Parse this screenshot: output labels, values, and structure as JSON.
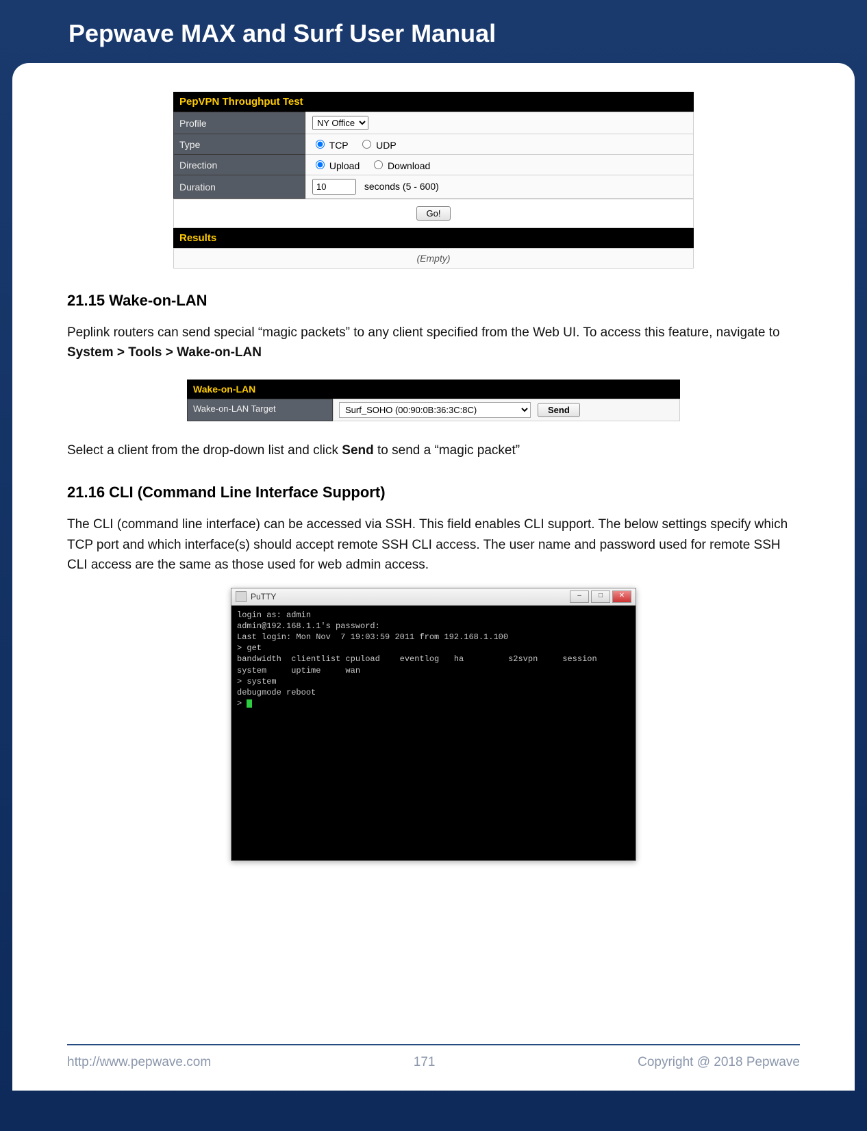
{
  "doc_title": "Pepwave MAX and Surf User Manual",
  "pepvpn": {
    "panel_title": "PepVPN Throughput Test",
    "rows": {
      "profile_label": "Profile",
      "profile_value": "NY Office",
      "type_label": "Type",
      "type_opt_tcp": "TCP",
      "type_opt_udp": "UDP",
      "direction_label": "Direction",
      "direction_opt_up": "Upload",
      "direction_opt_down": "Download",
      "duration_label": "Duration",
      "duration_value": "10",
      "duration_suffix": "seconds (5 - 600)"
    },
    "go_label": "Go!",
    "results_title": "Results",
    "results_empty": "(Empty)"
  },
  "section_wol": {
    "heading": "21.15 Wake-on-LAN",
    "para1_a": "Peplink routers can send special “magic packets” to any client specified from the Web UI. To access this feature, navigate to ",
    "para1_b_bold": "System > Tools > Wake-on-LAN",
    "panel_title": "Wake-on-LAN",
    "row_label": "Wake-on-LAN Target",
    "select_value": "Surf_SOHO (00:90:0B:36:3C:8C)",
    "send_label": "Send",
    "para2_a": "Select a client from the drop-down list and click ",
    "para2_b_bold": "Send",
    "para2_c": " to send a “magic packet”"
  },
  "section_cli": {
    "heading": "21.16 CLI (Command Line Interface Support)",
    "para": "The CLI (command line interface) can be accessed via SSH. This field enables CLI support. The below settings specify which TCP port and which interface(s) should accept remote SSH CLI access. The user name and password used for remote SSH CLI access are the same as those used for web admin access.",
    "putty_title": "PuTTY",
    "terminal_text": "login as: admin\nadmin@192.168.1.1's password:\nLast login: Mon Nov  7 19:03:59 2011 from 192.168.1.100\n> get\nbandwidth  clientlist cpuload    eventlog   ha         s2svpn     session\nsystem     uptime     wan\n> system\ndebugmode reboot\n> "
  },
  "footer": {
    "url": "http://www.pepwave.com",
    "page": "171",
    "copyright": "Copyright @ 2018 Pepwave"
  }
}
